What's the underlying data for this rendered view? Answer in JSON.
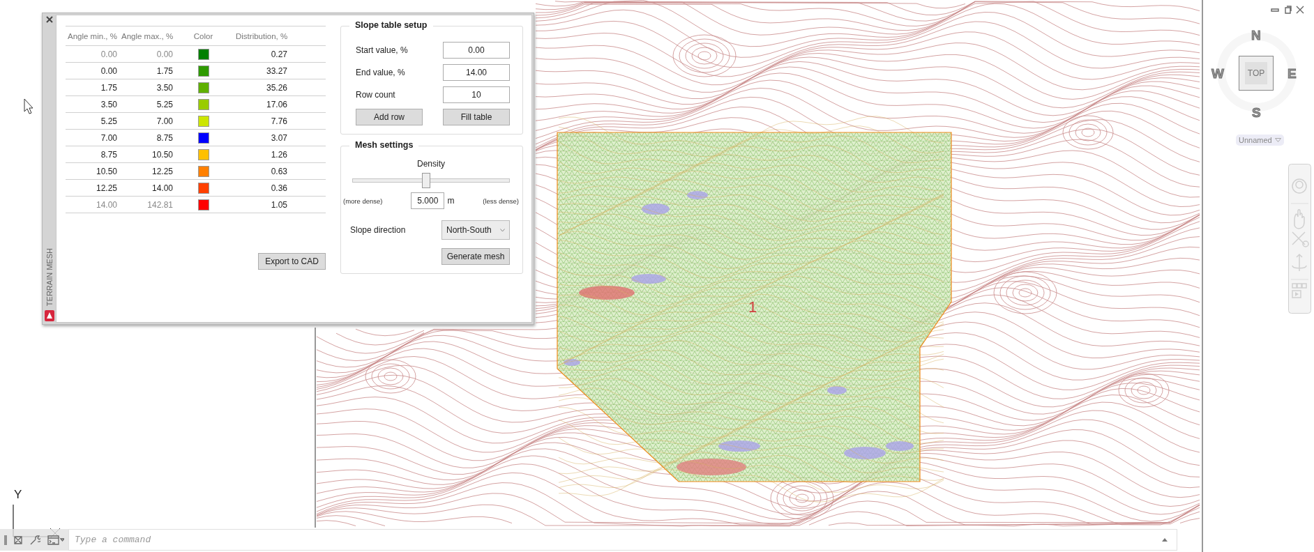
{
  "panel": {
    "side_title": "TERRAIN MESH"
  },
  "table": {
    "columns": [
      "Angle min., %",
      "Angle max., %",
      "Color",
      "Distribution, %"
    ],
    "rows": [
      {
        "angle_min": "0.00",
        "angle_max": "0.00",
        "color": "#007f00",
        "distribution": "0.27",
        "dimmed": true
      },
      {
        "angle_min": "0.00",
        "angle_max": "1.75",
        "color": "#2e9a00",
        "distribution": "33.27",
        "dimmed": false
      },
      {
        "angle_min": "1.75",
        "angle_max": "3.50",
        "color": "#5fb000",
        "distribution": "35.26",
        "dimmed": false
      },
      {
        "angle_min": "3.50",
        "angle_max": "5.25",
        "color": "#99cc00",
        "distribution": "17.06",
        "dimmed": false
      },
      {
        "angle_min": "5.25",
        "angle_max": "7.00",
        "color": "#cce600",
        "distribution": "7.76",
        "dimmed": false
      },
      {
        "angle_min": "7.00",
        "angle_max": "8.75",
        "color": "#0000ff",
        "distribution": "3.07",
        "dimmed": false
      },
      {
        "angle_min": "8.75",
        "angle_max": "10.50",
        "color": "#ffc000",
        "distribution": "1.26",
        "dimmed": false
      },
      {
        "angle_min": "10.50",
        "angle_max": "12.25",
        "color": "#ff8000",
        "distribution": "0.63",
        "dimmed": false
      },
      {
        "angle_min": "12.25",
        "angle_max": "14.00",
        "color": "#ff4000",
        "distribution": "0.36",
        "dimmed": false
      },
      {
        "angle_min": "14.00",
        "angle_max": "142.81",
        "color": "#ff0000",
        "distribution": "1.05",
        "dimmed": true
      }
    ]
  },
  "export_button": "Export to CAD",
  "slope_table_setup": {
    "title": "Slope table setup",
    "fields": [
      {
        "label": "Start value, %",
        "value": "0.00"
      },
      {
        "label": "End value, %",
        "value": "14.00"
      },
      {
        "label": "Row count",
        "value": "10"
      }
    ],
    "buttons": [
      "Add row",
      "Fill table"
    ]
  },
  "mesh_settings": {
    "title": "Mesh settings",
    "density": {
      "label": "Density",
      "level": 0.47,
      "min_label": "(more dense)",
      "max_label": "(less dense)",
      "value": "5.000",
      "unit": "m"
    },
    "slope_direction": {
      "label": "Slope direction",
      "value": "North-South"
    },
    "button": "Generate mesh"
  },
  "drawing": {
    "marker": "1",
    "ucs_axis": "Y"
  },
  "viewcube": {
    "north": "N",
    "east": "E",
    "south": "S",
    "west": "W",
    "face": "TOP",
    "view_name": "Unnamed"
  },
  "command_line": {
    "placeholder": "Type a command"
  }
}
